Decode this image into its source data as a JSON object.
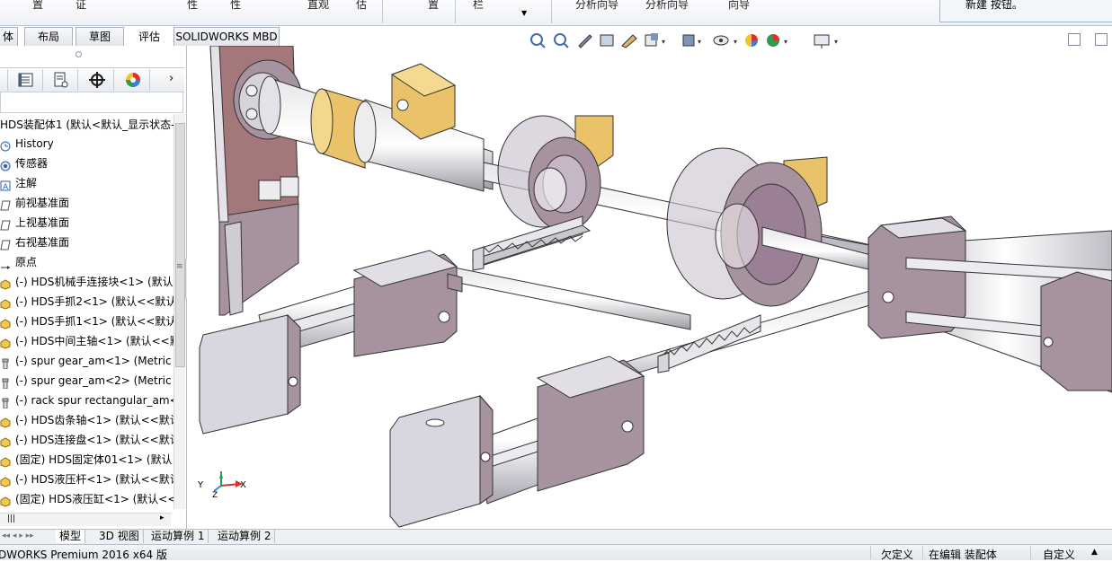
{
  "ribbon": {
    "groups": [
      "",
      "",
      "",
      "",
      "",
      "",
      "",
      "",
      "",
      "",
      "",
      ""
    ],
    "labels": [
      "置",
      "证",
      "性",
      "性",
      "直观",
      "估",
      "置",
      "栏",
      "分析向导",
      "分析向导",
      "向导"
    ],
    "tip_text": "新建  按钮。"
  },
  "command_tabs": [
    {
      "label": "体"
    },
    {
      "label": "布局"
    },
    {
      "label": "草图"
    },
    {
      "label": "评估"
    },
    {
      "label": "SOLIDWORKS MBD"
    }
  ],
  "tree": {
    "root": "HDS装配体1 (默认<默认_显示状态-",
    "items": [
      {
        "label": "History",
        "icon": "history-icon"
      },
      {
        "label": "传感器",
        "icon": "sensor-icon"
      },
      {
        "label": "注解",
        "icon": "annotation-icon"
      },
      {
        "label": "前视基准面",
        "icon": "plane-icon"
      },
      {
        "label": "上视基准面",
        "icon": "plane-icon"
      },
      {
        "label": "右视基准面",
        "icon": "plane-icon"
      },
      {
        "label": "原点",
        "icon": "origin-icon"
      },
      {
        "label": "(-) HDS机械手连接块<1> (默认",
        "icon": "part-icon"
      },
      {
        "label": "(-) HDS手抓2<1> (默认<<默认",
        "icon": "part-icon"
      },
      {
        "label": "(-) HDS手抓1<1> (默认<<默认",
        "icon": "part-icon"
      },
      {
        "label": "(-) HDS中间主轴<1> (默认<<默",
        "icon": "part-icon"
      },
      {
        "label": "(-) spur gear_am<1> (Metric -",
        "icon": "toolbox-icon"
      },
      {
        "label": "(-) spur gear_am<2> (Metric -",
        "icon": "toolbox-icon"
      },
      {
        "label": "(-) rack spur rectangular_am<",
        "icon": "toolbox-icon"
      },
      {
        "label": "(-) HDS齿条轴<1> (默认<<默认",
        "icon": "part-icon"
      },
      {
        "label": "(-) HDS连接盘<1> (默认<<默认",
        "icon": "part-icon"
      },
      {
        "label": "(固定) HDS固定体01<1> (默认<",
        "icon": "part-icon"
      },
      {
        "label": "(-) HDS液压杆<1> (默认<<默认",
        "icon": "part-icon"
      },
      {
        "label": "(固定) HDS液压缸<1> (默认<<",
        "icon": "part-icon"
      }
    ]
  },
  "bottom_tabs": [
    {
      "label": "模型"
    },
    {
      "label": "3D 视图"
    },
    {
      "label": "运动算例 1"
    },
    {
      "label": "运动算例 2"
    }
  ],
  "status": {
    "app": "DWORKS Premium 2016 x64 版",
    "underdefined": "欠定义",
    "editing": "在编辑 装配体",
    "custom": "自定义"
  },
  "triad": {
    "x": "X",
    "y": "Y",
    "z": "Z"
  },
  "colors": {
    "accent": "#2b5fa8",
    "cylinder_body": "#d9d6df",
    "plate_purple": "#9a7f96",
    "brass": "#e9c26a"
  }
}
